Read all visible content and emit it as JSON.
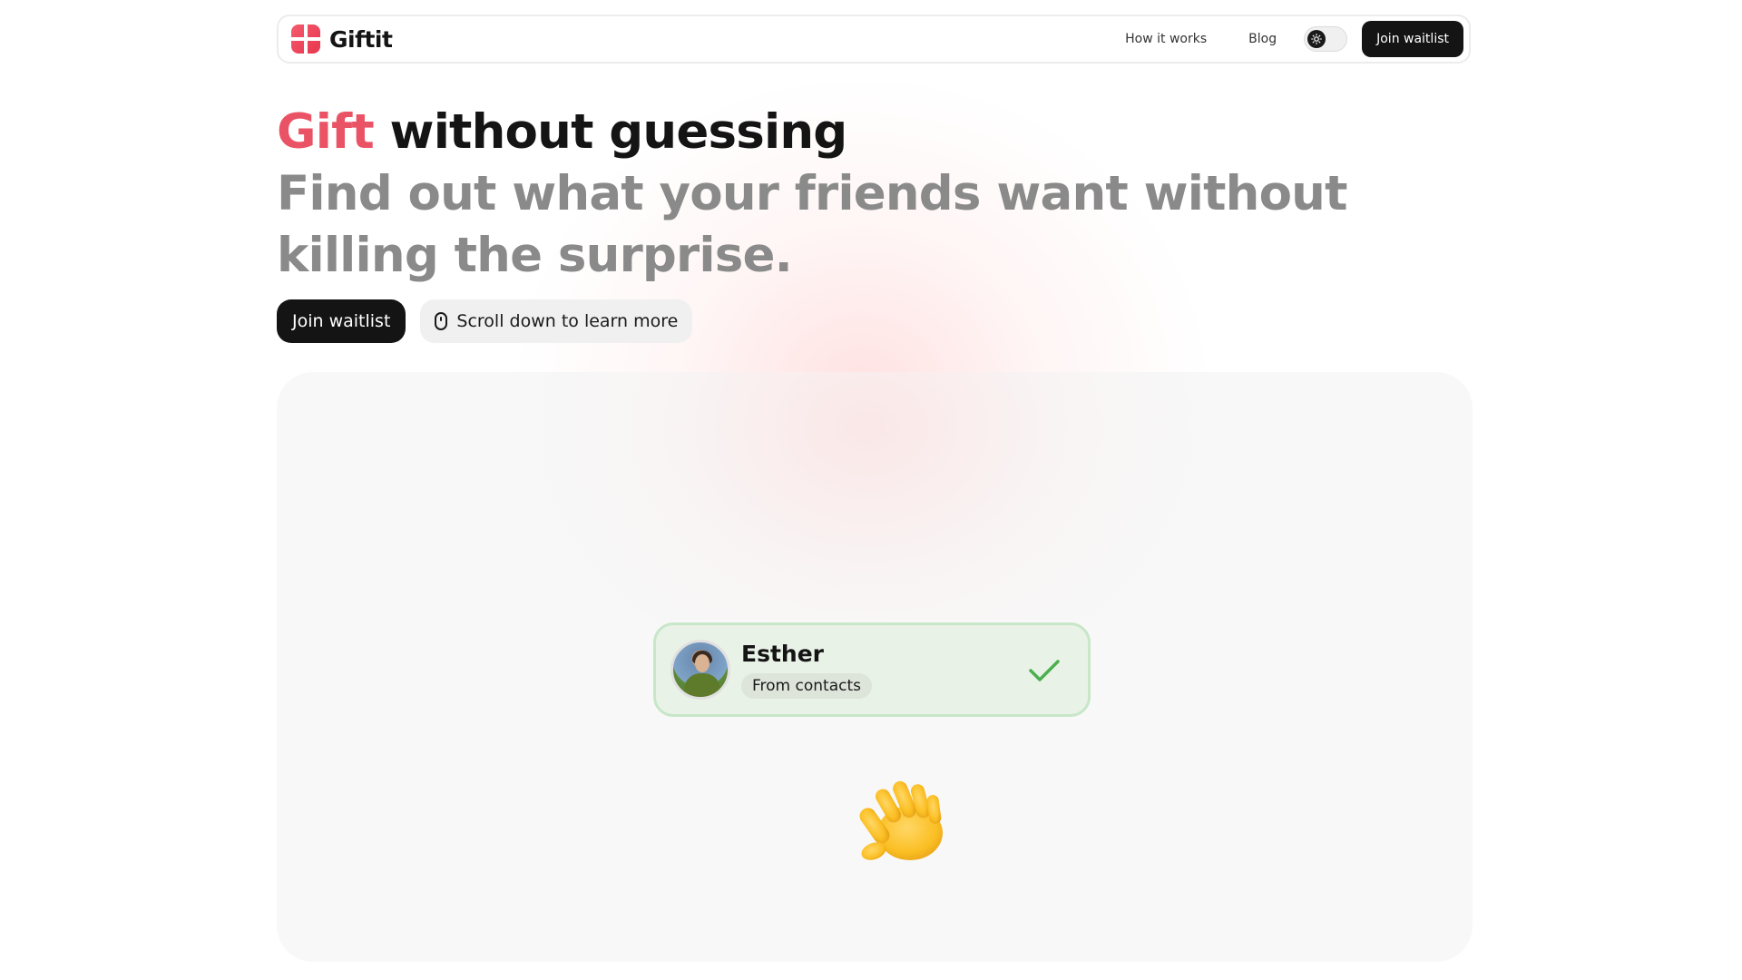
{
  "nav": {
    "brand": "Giftit",
    "links": [
      "How it works",
      "Blog"
    ],
    "cta": "Join waitlist"
  },
  "hero": {
    "headline_accent": "Gift",
    "headline_rest": " without guessing",
    "subtitle": "Find out what your friends want without killing the surprise.",
    "primary_cta": "Join waitlist",
    "secondary_cta": "Scroll down to learn more"
  },
  "showcase": {
    "contact": {
      "name": "Esther",
      "source": "From contacts"
    }
  },
  "colors": {
    "accent": "#ea5365",
    "dark": "#141414",
    "card_bg": "#e9f2e7",
    "check": "#4caf50"
  },
  "icons": [
    "logo-icon",
    "theme-toggle-icon",
    "mouse-scroll-icon",
    "check-icon",
    "waving-hand-icon"
  ]
}
